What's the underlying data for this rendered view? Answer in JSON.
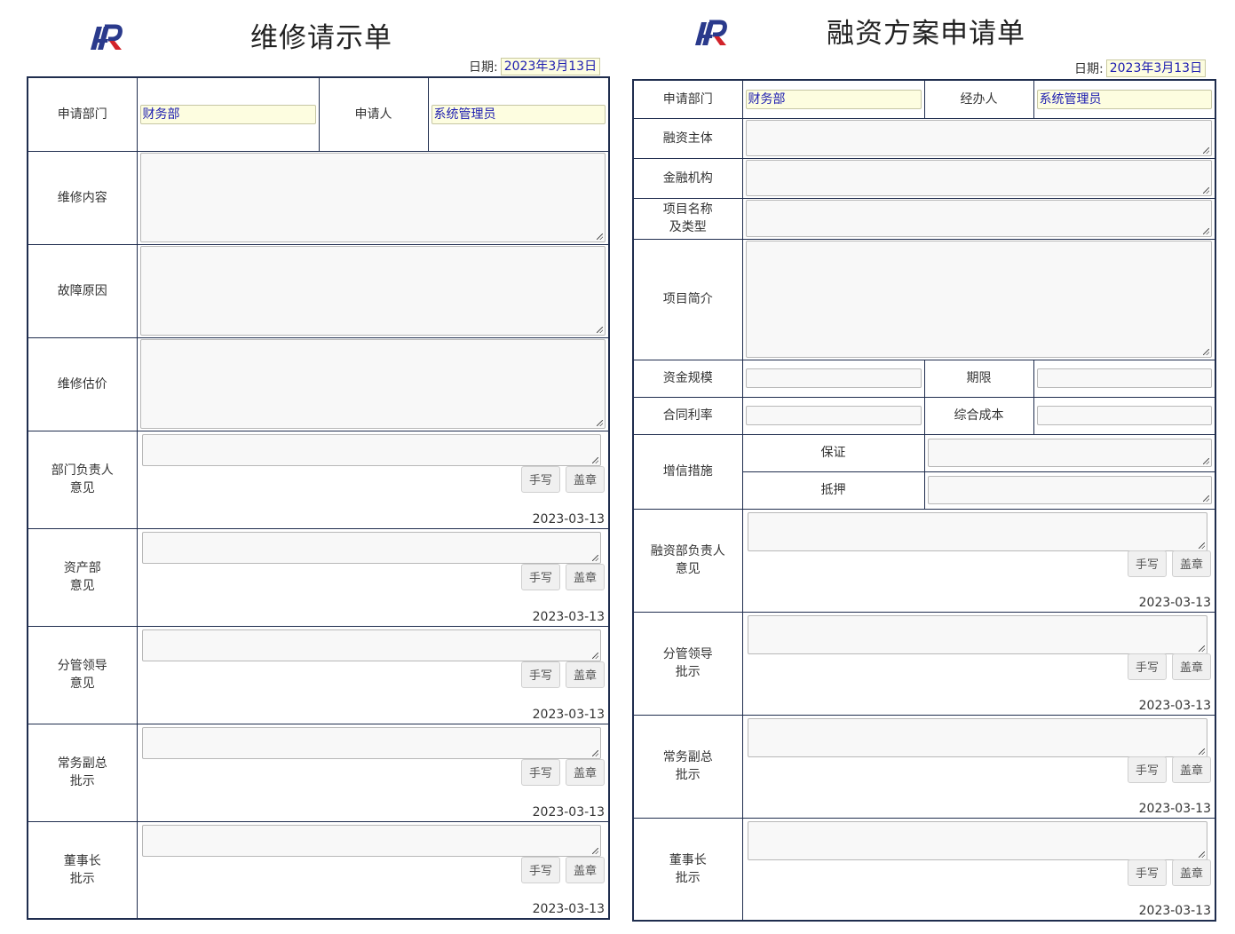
{
  "brand": {
    "color": "#2a3a8c",
    "accent": "#d2232a"
  },
  "repair_form": {
    "title": "维修请示单",
    "date_label": "日期:",
    "date_value": "2023年3月13日",
    "apply_dept_label": "申请部门",
    "apply_dept_value": "财务部",
    "applicant_label": "申请人",
    "applicant_value": "系统管理员",
    "content_label": "维修内容",
    "cause_label": "故障原因",
    "estimate_label": "维修估价",
    "opinions": [
      {
        "label": "部门负责人\n意见",
        "hand": "手写",
        "stamp": "盖章",
        "date": "2023-03-13"
      },
      {
        "label": "资产部\n意见",
        "hand": "手写",
        "stamp": "盖章",
        "date": "2023-03-13"
      },
      {
        "label": "分管领导\n意见",
        "hand": "手写",
        "stamp": "盖章",
        "date": "2023-03-13"
      },
      {
        "label": "常务副总\n批示",
        "hand": "手写",
        "stamp": "盖章",
        "date": "2023-03-13"
      },
      {
        "label": "董事长\n批示",
        "hand": "手写",
        "stamp": "盖章",
        "date": "2023-03-13"
      }
    ]
  },
  "finance_form": {
    "title": "融资方案申请单",
    "date_label": "日期:",
    "date_value": "2023年3月13日",
    "apply_dept_label": "申请部门",
    "apply_dept_value": "财务部",
    "handler_label": "经办人",
    "handler_value": "系统管理员",
    "subject_label": "融资主体",
    "institution_label": "金融机构",
    "project_name_label": "项目名称\n及类型",
    "project_intro_label": "项目简介",
    "capital_label": "资金规模",
    "term_label": "期限",
    "rate_label": "合同利率",
    "cost_label": "综合成本",
    "credit_label": "增信措施",
    "guarantee_label": "保证",
    "mortgage_label": "抵押",
    "opinions": [
      {
        "label": "融资部负责人\n意见",
        "hand": "手写",
        "stamp": "盖章",
        "date": "2023-03-13"
      },
      {
        "label": "分管领导\n批示",
        "hand": "手写",
        "stamp": "盖章",
        "date": "2023-03-13"
      },
      {
        "label": "常务副总\n批示",
        "hand": "手写",
        "stamp": "盖章",
        "date": "2023-03-13"
      },
      {
        "label": "董事长\n批示",
        "hand": "手写",
        "stamp": "盖章",
        "date": "2023-03-13"
      }
    ]
  }
}
